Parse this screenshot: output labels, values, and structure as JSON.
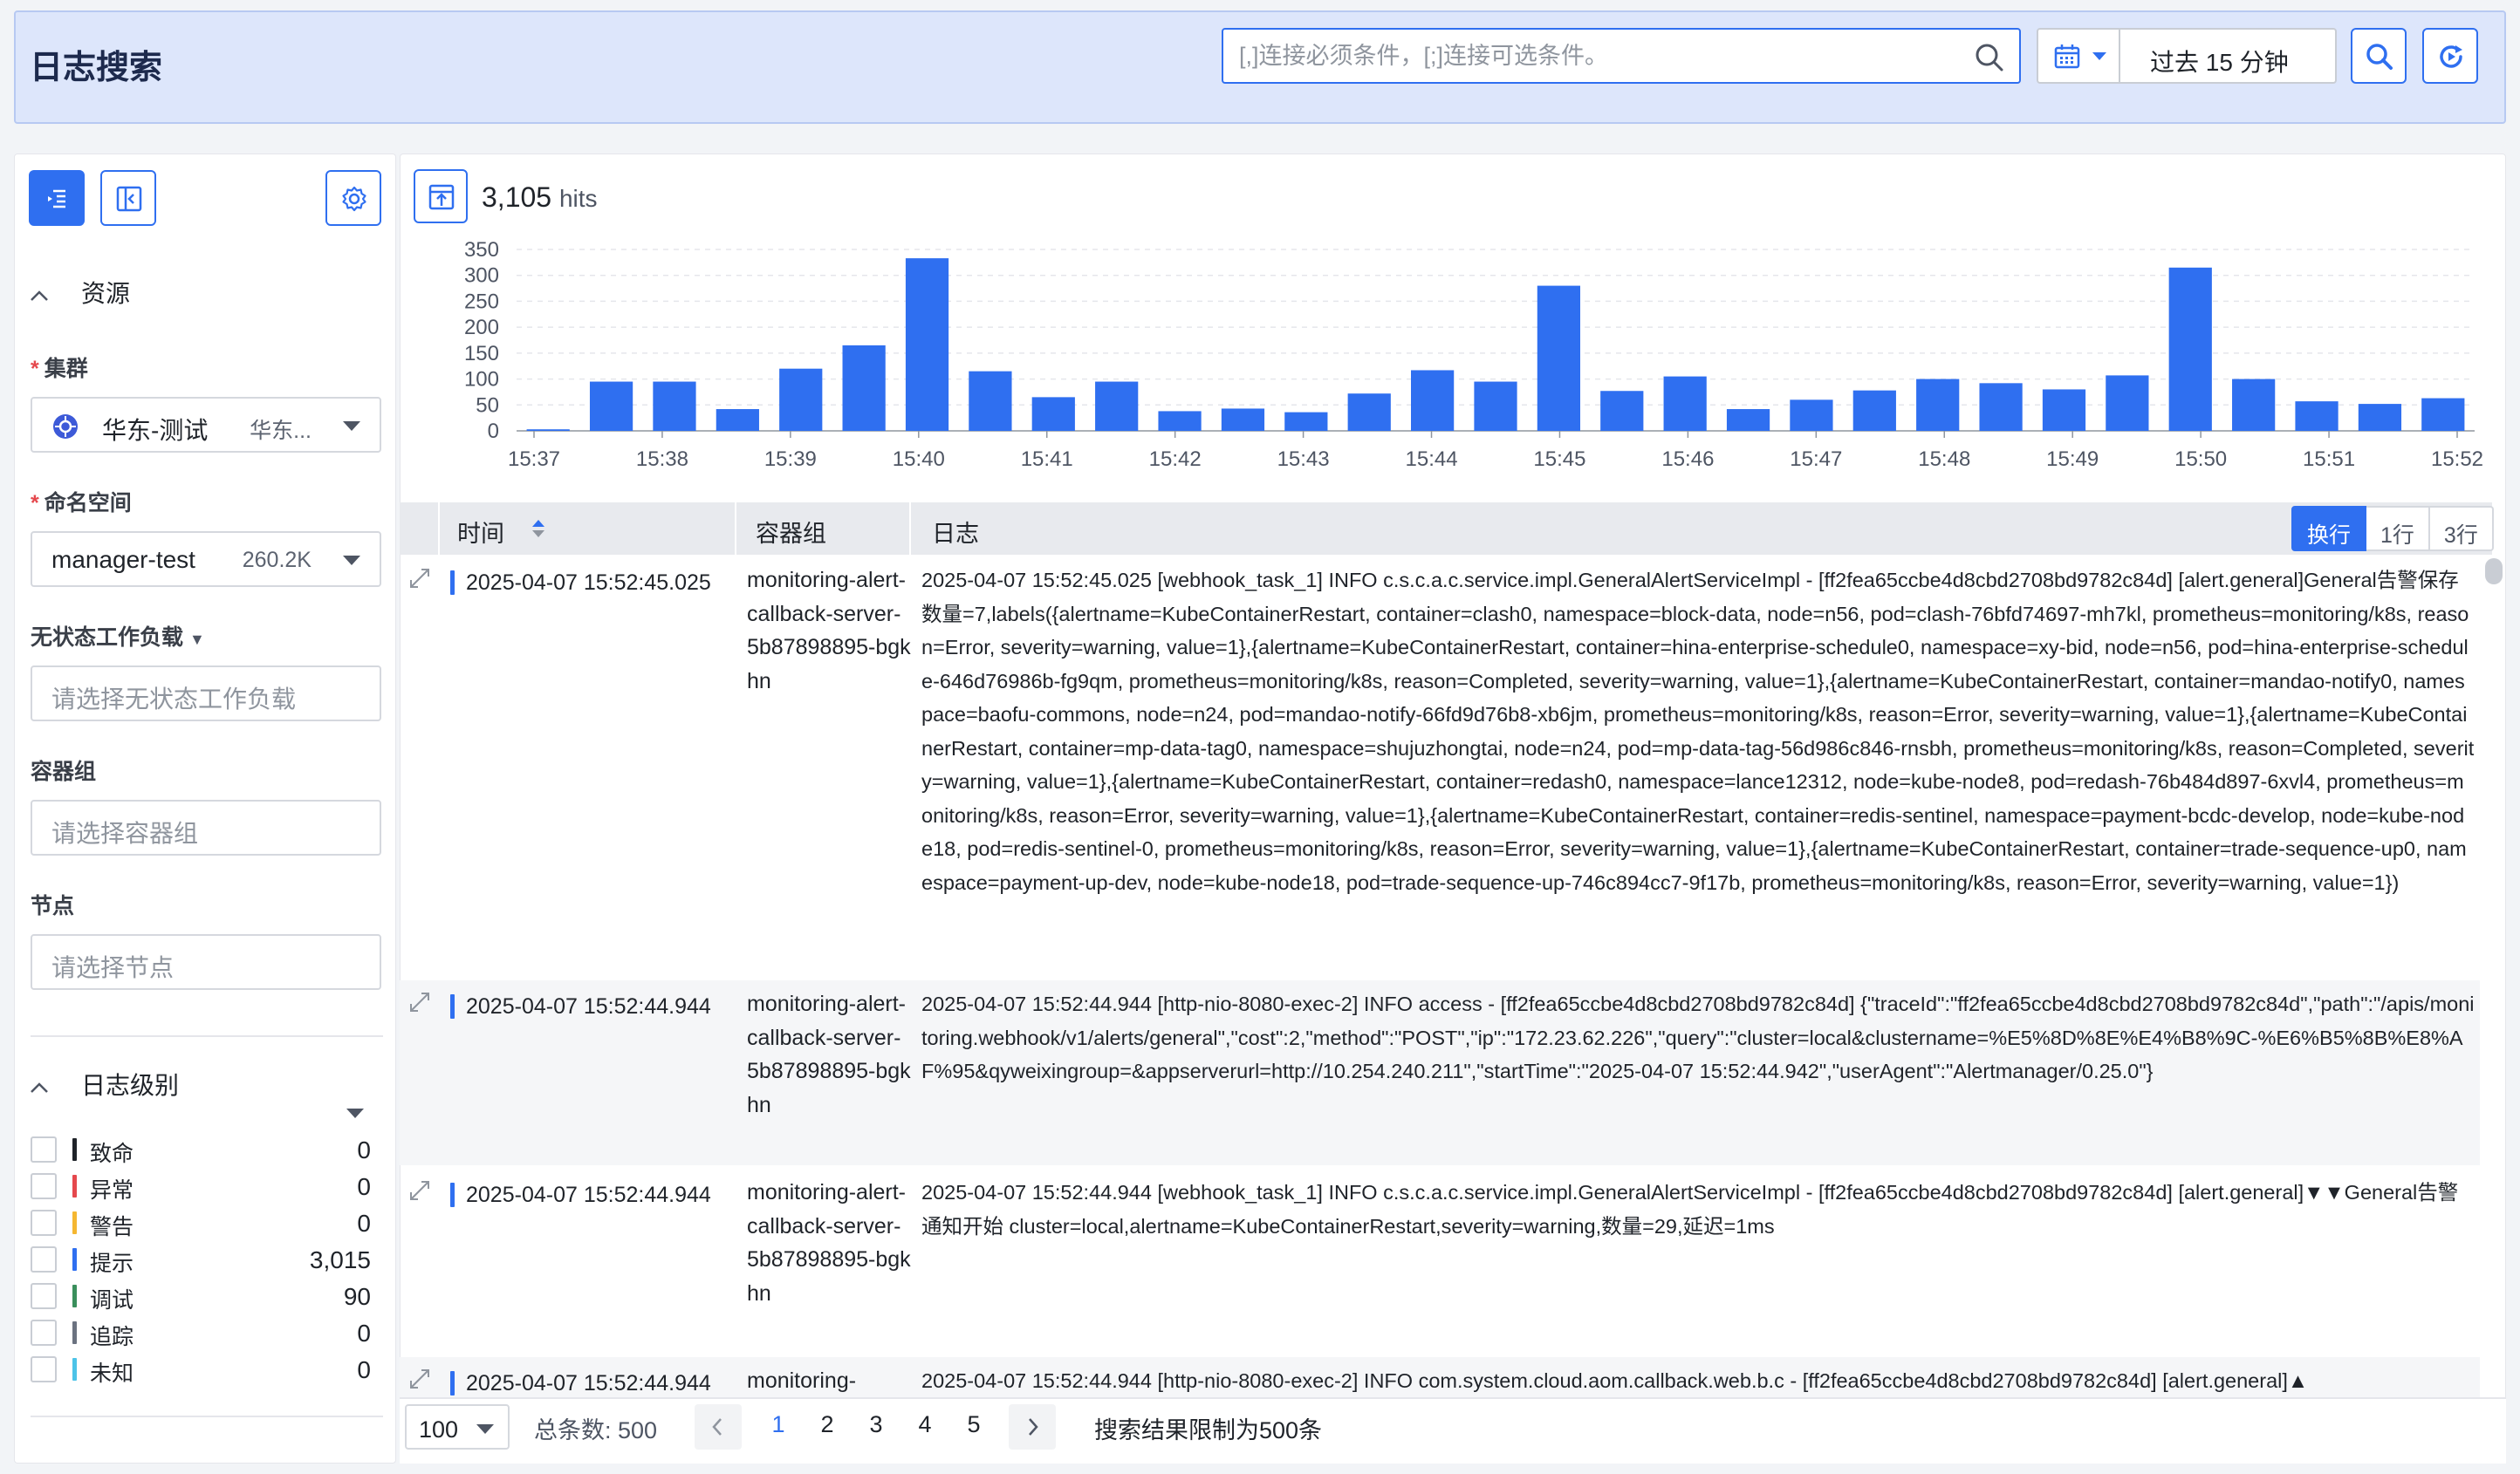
{
  "header": {
    "title": "日志搜索",
    "search_placeholder": "[,]连接必须条件，[;]连接可选条件。",
    "time_range": "过去 15 分钟"
  },
  "sidebar": {
    "resource_section": "资源",
    "cluster": {
      "label": "集群",
      "value": "华东-测试",
      "sub": "华东..."
    },
    "namespace": {
      "label": "命名空间",
      "value": "manager-test",
      "count": "260.2K"
    },
    "stateless": {
      "label": "无状态工作负载",
      "placeholder": "请选择无状态工作负载"
    },
    "podgroup": {
      "label": "容器组",
      "placeholder": "请选择容器组"
    },
    "node": {
      "label": "节点",
      "placeholder": "请选择节点"
    },
    "level_section": "日志级别",
    "levels": [
      {
        "name": "致命",
        "count": "0",
        "color": "#1f2329"
      },
      {
        "name": "异常",
        "count": "0",
        "color": "#e5484d"
      },
      {
        "name": "警告",
        "count": "0",
        "color": "#f5b731"
      },
      {
        "name": "提示",
        "count": "3,015",
        "color": "#2f6ff0"
      },
      {
        "name": "调试",
        "count": "90",
        "color": "#3a8f5c"
      },
      {
        "name": "追踪",
        "count": "0",
        "color": "#6b7280"
      },
      {
        "name": "未知",
        "count": "0",
        "color": "#4cc3e8"
      }
    ]
  },
  "hits": {
    "count": "3,105",
    "unit": "hits"
  },
  "chart_data": {
    "type": "bar",
    "color": "#2f6ff0",
    "ylim": [
      0,
      350
    ],
    "yticks": [
      0,
      50,
      100,
      150,
      200,
      250,
      300,
      350
    ],
    "xticks": [
      "15:37",
      "15:38",
      "15:39",
      "15:40",
      "15:41",
      "15:42",
      "15:43",
      "15:44",
      "15:45",
      "15:46",
      "15:47",
      "15:48",
      "15:49",
      "15:50",
      "15:51",
      "15:52"
    ],
    "values": [
      3,
      95,
      95,
      42,
      120,
      165,
      333,
      115,
      65,
      95,
      38,
      43,
      36,
      72,
      117,
      95,
      280,
      77,
      105,
      42,
      60,
      78,
      100,
      92,
      80,
      107,
      315,
      100,
      57,
      52,
      63
    ]
  },
  "table": {
    "col_time": "时间",
    "col_pod": "容器组",
    "col_log": "日志",
    "wrap_options": [
      "换行",
      "1行",
      "3行"
    ],
    "rows": [
      {
        "time": "2025-04-07 15:52:45.025",
        "pod": "monitoring-alert-callback-server-5b87898895-bgkhn",
        "log": "2025-04-07 15:52:45.025 [webhook_task_1] INFO  c.s.c.a.c.service.impl.GeneralAlertServiceImpl - [ff2fea65ccbe4d8cbd2708bd9782c84d] [alert.general]General告警保存 数量=7,labels({alertname=KubeContainerRestart, container=clash0, namespace=block-data, node=n56, pod=clash-76bfd74697-mh7kl, prometheus=monitoring/k8s, reason=Error, severity=warning, value=1},{alertname=KubeContainerRestart, container=hina-enterprise-schedule0, namespace=xy-bid, node=n56, pod=hina-enterprise-schedule-646d76986b-fg9qm, prometheus=monitoring/k8s, reason=Completed, severity=warning, value=1},{alertname=KubeContainerRestart, container=mandao-notify0, namespace=baofu-commons, node=n24, pod=mandao-notify-66fd9d76b8-xb6jm, prometheus=monitoring/k8s, reason=Error, severity=warning, value=1},{alertname=KubeContainerRestart, container=mp-data-tag0, namespace=shujuzhongtai, node=n24, pod=mp-data-tag-56d986c846-rnsbh, prometheus=monitoring/k8s, reason=Completed, severity=warning, value=1},{alertname=KubeContainerRestart, container=redash0, namespace=lance12312, node=kube-node8, pod=redash-76b484d897-6xvl4, prometheus=monitoring/k8s, reason=Error, severity=warning, value=1},{alertname=KubeContainerRestart, container=redis-sentinel, namespace=payment-bcdc-develop, node=kube-node18, pod=redis-sentinel-0, prometheus=monitoring/k8s, reason=Error, severity=warning, value=1},{alertname=KubeContainerRestart, container=trade-sequence-up0, namespace=payment-up-dev, node=kube-node18, pod=trade-sequence-up-746c894cc7-9f17b, prometheus=monitoring/k8s, reason=Error, severity=warning, value=1})"
      },
      {
        "time": "2025-04-07 15:52:44.944",
        "pod": "monitoring-alert-callback-server-5b87898895-bgkhn",
        "log": "2025-04-07 15:52:44.944 [http-nio-8080-exec-2] INFO  access - [ff2fea65ccbe4d8cbd2708bd9782c84d] {\"traceId\":\"ff2fea65ccbe4d8cbd2708bd9782c84d\",\"path\":\"/apis/monitoring.webhook/v1/alerts/general\",\"cost\":2,\"method\":\"POST\",\"ip\":\"172.23.62.226\",\"query\":\"cluster=local&clustername=%E5%8D%8E%E4%B8%9C-%E6%B5%8B%E8%AF%95&qyweixingroup=&appserverurl=http://10.254.240.211\",\"startTime\":\"2025-04-07 15:52:44.942\",\"userAgent\":\"Alertmanager/0.25.0\"}"
      },
      {
        "time": "2025-04-07 15:52:44.944",
        "pod": "monitoring-alert-callback-server-5b87898895-bgkhn",
        "log": "2025-04-07 15:52:44.944 [webhook_task_1] INFO  c.s.c.a.c.service.impl.GeneralAlertServiceImpl - [ff2fea65ccbe4d8cbd2708bd9782c84d] [alert.general]▼▼General告警通知开始 cluster=local,alertname=KubeContainerRestart,severity=warning,数量=29,延迟=1ms"
      },
      {
        "time": "2025-04-07 15:52:44.944",
        "pod": "monitoring-",
        "log": "2025-04-07 15:52:44.944 [http-nio-8080-exec-2] INFO  com.system.cloud.aom.callback.web.b.c - [ff2fea65ccbe4d8cbd2708bd9782c84d] [alert.general]▲"
      }
    ]
  },
  "footer": {
    "page_size": "100",
    "total": "总条数: 500",
    "pages": [
      "1",
      "2",
      "3",
      "4",
      "5"
    ],
    "limit_note": "搜索结果限制为500条"
  }
}
